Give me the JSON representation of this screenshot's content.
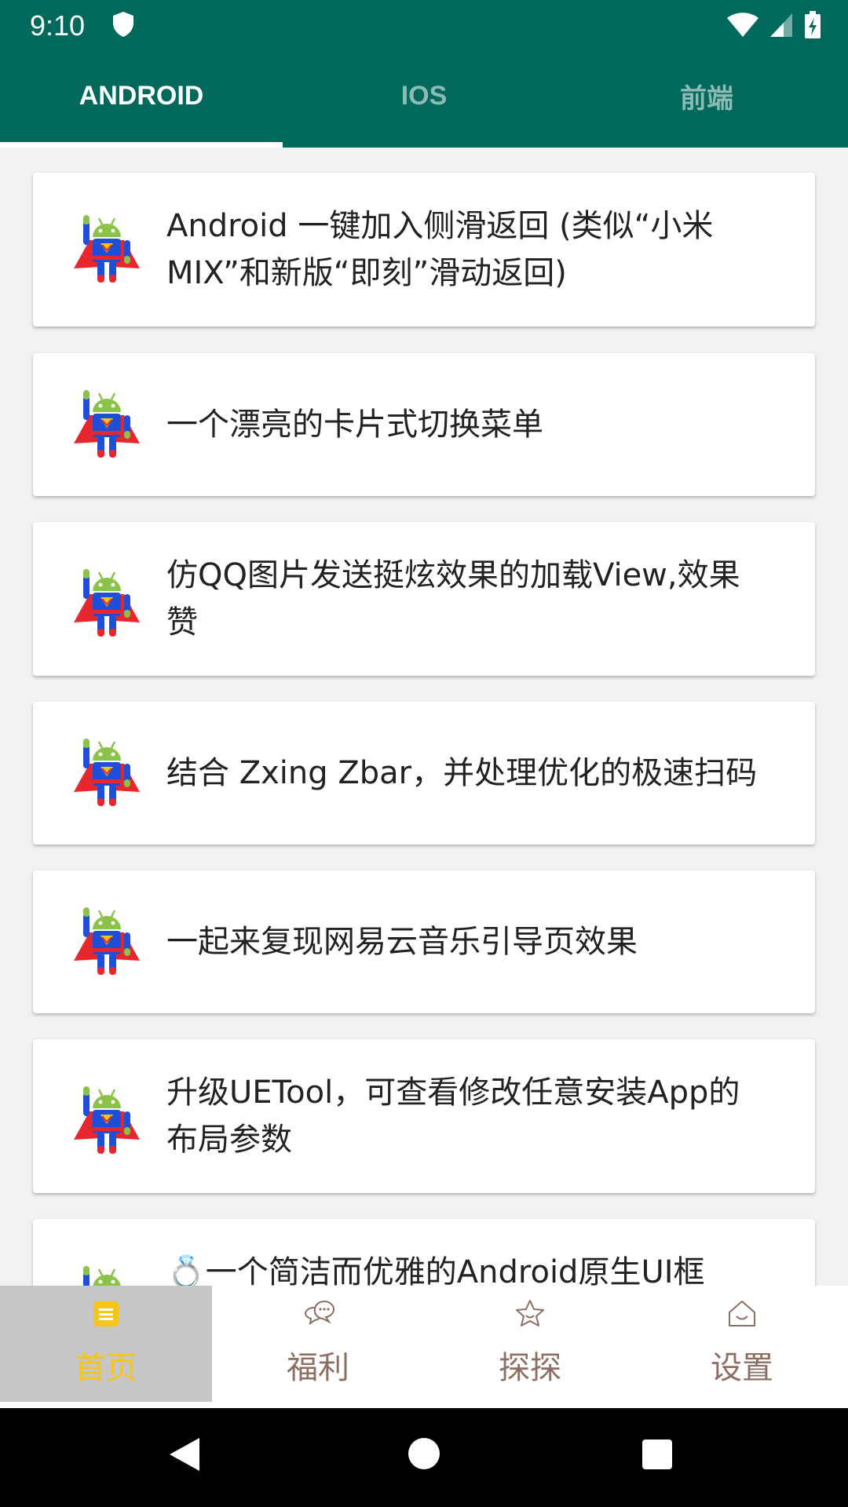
{
  "status_bar": {
    "time": "9:10"
  },
  "tabs": [
    {
      "label": "ANDROID",
      "active": true
    },
    {
      "label": "IOS",
      "active": false
    },
    {
      "label": "前端",
      "active": false
    }
  ],
  "articles": [
    {
      "title": "Android 一键加入侧滑返回 (类似“小米MIX”和新版“即刻”滑动返回)",
      "icon": "superman-android-icon"
    },
    {
      "title": "一个漂亮的卡片式切换菜单",
      "icon": "superman-android-icon"
    },
    {
      "title": "仿QQ图片发送挺炫效果的加载View,效果赞",
      "icon": "superman-android-icon"
    },
    {
      "title": "结合 Zxing Zbar，并处理优化的极速扫码",
      "icon": "superman-android-icon"
    },
    {
      "title": "一起来复现网易云音乐引导页效果",
      "icon": "superman-android-icon"
    },
    {
      "title": "升级UETool，可查看修改任意安装App的布局参数",
      "icon": "superman-android-icon"
    },
    {
      "title": "💍一个简洁而优雅的Android原生UI框",
      "icon": "superman-android-icon"
    }
  ],
  "bottom_nav": [
    {
      "label": "首页",
      "icon": "home-list-icon",
      "active": true
    },
    {
      "label": "福利",
      "icon": "chat-bubbles-icon",
      "active": false
    },
    {
      "label": "探探",
      "icon": "star-icon",
      "active": false
    },
    {
      "label": "设置",
      "icon": "house-smile-icon",
      "active": false
    }
  ],
  "colors": {
    "primary": "#00695c",
    "nav_active": "#f5c518",
    "nav_inactive": "#8d6e63",
    "nav_active_bg": "#c6c6c6"
  }
}
